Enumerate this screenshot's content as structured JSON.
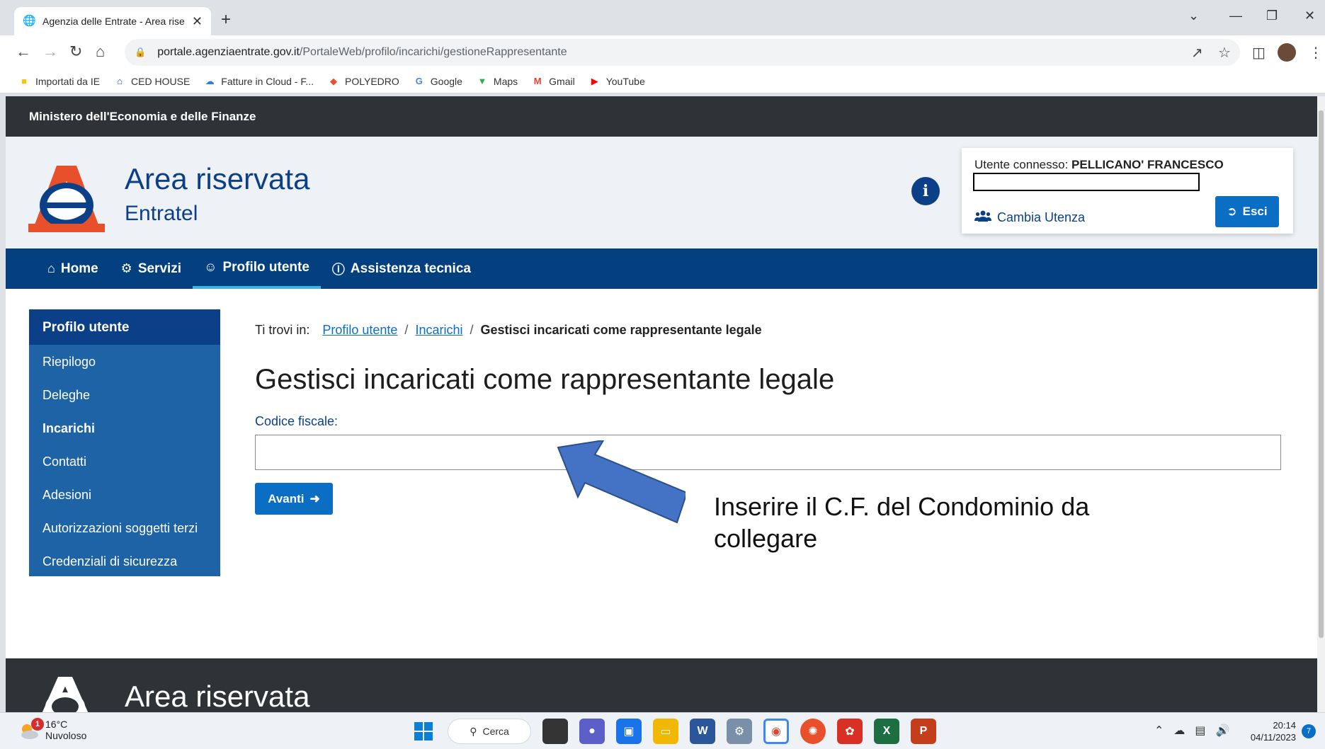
{
  "browser": {
    "tab_title": "Agenzia delle Entrate - Area rise",
    "url_host": "portale.agenziaentrate.gov.it",
    "url_path": "/PortaleWeb/profilo/incarichi/gestioneRappresentante",
    "bookmarks": [
      {
        "label": "Importati da IE",
        "icon": "folder-icon",
        "color": "#f5c518"
      },
      {
        "label": "CED HOUSE",
        "icon": "house-icon",
        "color": "#1a5fb4"
      },
      {
        "label": "Fatture in Cloud - F...",
        "icon": "cloud-icon",
        "color": "#2a7de1"
      },
      {
        "label": "POLYEDRO",
        "icon": "polyedro-icon",
        "color": "#e8502b"
      },
      {
        "label": "Google",
        "icon": "google-icon",
        "color": "#4285f4"
      },
      {
        "label": "Maps",
        "icon": "maps-pin-icon",
        "color": "#34a853"
      },
      {
        "label": "Gmail",
        "icon": "gmail-icon",
        "color": "#ea4335"
      },
      {
        "label": "YouTube",
        "icon": "youtube-icon",
        "color": "#ff0000"
      }
    ]
  },
  "page": {
    "ministry": "Ministero dell'Economia e delle Finanze",
    "brand_title": "Area riservata",
    "brand_subtitle": "Entratel",
    "user_label": "Utente connesso:",
    "user_name": "PELLICANO' FRANCESCO",
    "cambia_utenza": "Cambia Utenza",
    "esci": "Esci",
    "nav": [
      {
        "label": "Home",
        "icon": "home-icon"
      },
      {
        "label": "Servizi",
        "icon": "services-icon"
      },
      {
        "label": "Profilo utente",
        "icon": "user-icon",
        "active": true
      },
      {
        "label": "Assistenza tecnica",
        "icon": "info-icon"
      }
    ],
    "sidebar": {
      "title": "Profilo utente",
      "items": [
        "Riepilogo",
        "Deleghe",
        "Incarichi",
        "Contatti",
        "Adesioni",
        "Autorizzazioni soggetti terzi",
        "Credenziali di sicurezza"
      ],
      "active": "Incarichi"
    },
    "breadcrumb": {
      "prefix": "Ti trovi in:",
      "links": [
        "Profilo utente",
        "Incarichi"
      ],
      "current": "Gestisci incaricati come rappresentante legale"
    },
    "heading": "Gestisci incaricati come rappresentante legale",
    "cf_label": "Codice fiscale:",
    "cf_value": "",
    "avanti": "Avanti",
    "annotation": "Inserire il C.F. del Condominio da collegare",
    "footer_title": "Area riservata"
  },
  "colors": {
    "brand_blue": "#0b4089",
    "nav_blue": "#04407f",
    "button_blue": "#0b6ec5",
    "arrow_blue": "#4472c4",
    "dark_bar": "#2f3337"
  },
  "taskbar": {
    "temperature": "16°C",
    "weather": "Nuvoloso",
    "weather_badge": "1",
    "search": "Cerca",
    "time": "20:14",
    "date": "04/11/2023",
    "notifications": "7"
  }
}
